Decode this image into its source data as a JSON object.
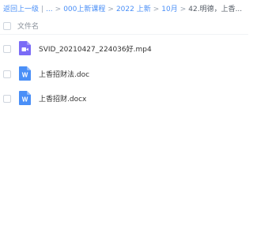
{
  "breadcrumb": {
    "back": "返回上一级",
    "ellipsis": "...",
    "items": [
      "000上新课程",
      "2022 上新",
      "10月"
    ],
    "current": "42.明德，上香...",
    "separator": ">",
    "divider": "|"
  },
  "list_header": {
    "name_column": "文件名"
  },
  "files": [
    {
      "name": "SVID_20210427_224036好.mp4",
      "type": "video",
      "icon": "video-file-icon",
      "color": "#7b6cf6"
    },
    {
      "name": "上香招财法.doc",
      "type": "word",
      "icon": "word-file-icon",
      "color": "#4a8ff7",
      "letter": "W"
    },
    {
      "name": "上香招财.docx",
      "type": "word",
      "icon": "word-file-icon",
      "color": "#4a8ff7",
      "letter": "W"
    }
  ],
  "colors": {
    "link": "#4a8ff7",
    "video_icon": "#7b6cf6",
    "word_icon": "#4a8ff7"
  }
}
